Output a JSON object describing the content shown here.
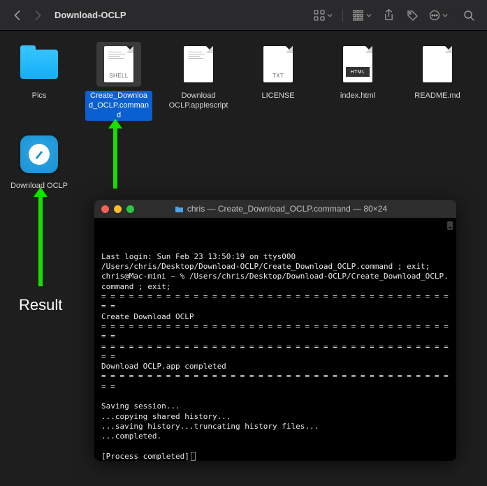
{
  "toolbar": {
    "title": "Download-OCLP"
  },
  "files": [
    {
      "name": "Pics",
      "type": "folder"
    },
    {
      "name": "Create_Download_OCLP.command",
      "type": "doc",
      "tag": "SHELL",
      "lines": true,
      "selected": true
    },
    {
      "name": "Download OCLP.applescript",
      "type": "doc",
      "lines": true
    },
    {
      "name": "LICENSE",
      "type": "doc",
      "tag": "TXT"
    },
    {
      "name": "index.html",
      "type": "doc",
      "html": true
    },
    {
      "name": "README.md",
      "type": "doc"
    },
    {
      "name": "Download OCLP",
      "type": "app",
      "row2": true
    }
  ],
  "result_label": "Result",
  "terminal": {
    "title": "chris — Create_Download_OCLP.command — 80×24",
    "lines": [
      "Last login: Sun Feb 23 13:50:19 on ttys000",
      "/Users/chris/Desktop/Download-OCLP/Create_Download_OCLP.command ; exit;",
      "chris@Mac-mini ~ % /Users/chris/Desktop/Download-OCLP/Create_Download_OCLP.command ; exit;",
      "= = = = = = = = = = = = = = = = = = = = = = = = = = = = = = = = = = = = = = = =",
      "Create Download OCLP",
      "= = = = = = = = = = = = = = = = = = = = = = = = = = = = = = = = = = = = = = = =",
      "= = = = = = = = = = = = = = = = = = = = = = = = = = = = = = = = = = = = = = = =",
      "Download OCLP.app completed",
      "= = = = = = = = = = = = = = = = = = = = = = = = = = = = = = = = = = = = = = = =",
      "",
      "Saving session...",
      "...copying shared history...",
      "...saving history...truncating history files...",
      "...completed.",
      "",
      "[Process completed]"
    ]
  }
}
